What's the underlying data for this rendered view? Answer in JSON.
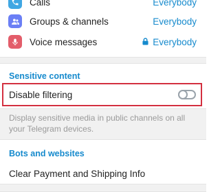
{
  "privacy_items": [
    {
      "label": "Calls",
      "value": "Everybody",
      "icon": "phone-icon",
      "color": "#40a7e3",
      "locked": false
    },
    {
      "label": "Groups & channels",
      "value": "Everybody",
      "icon": "group-icon",
      "color": "#6b7ff5",
      "locked": false
    },
    {
      "label": "Voice messages",
      "value": "Everybody",
      "icon": "microphone-icon",
      "color": "#e35d6a",
      "locked": true
    }
  ],
  "sensitive": {
    "header": "Sensitive content",
    "option_label": "Disable filtering",
    "toggle_on": false,
    "description": "Display sensitive media in public channels on all your Telegram devices."
  },
  "bots": {
    "header": "Bots and websites",
    "clear_payment_label": "Clear Payment and Shipping Info"
  },
  "colors": {
    "accent": "#168acd",
    "highlight_border": "#d32f3f"
  }
}
